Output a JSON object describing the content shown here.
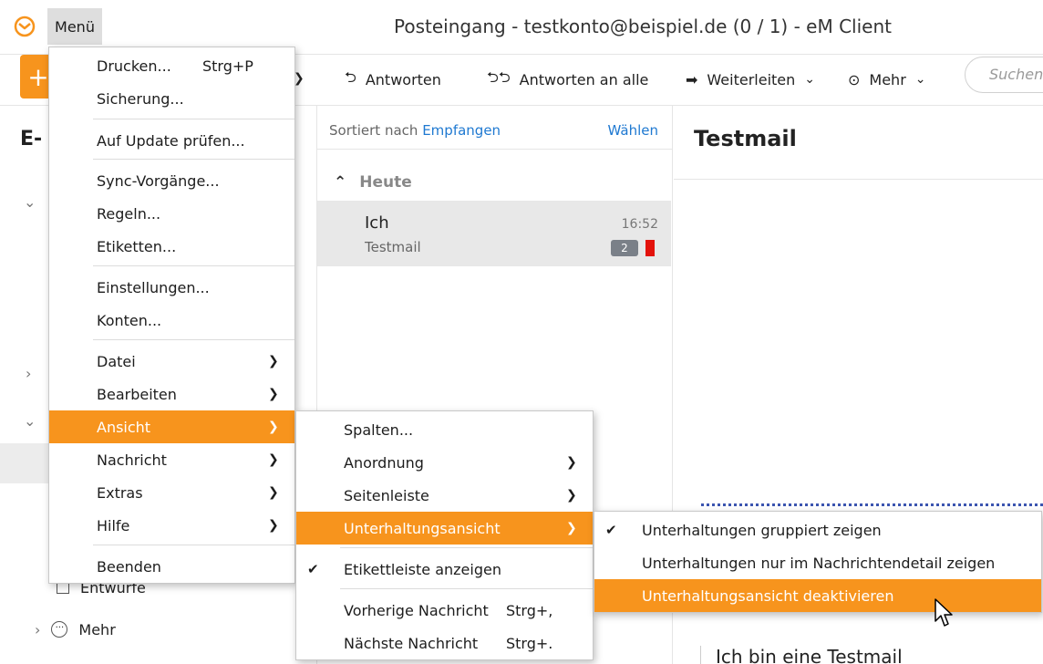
{
  "window": {
    "title": "Posteingang - testkonto@beispiel.de (0 / 1) - eM Client",
    "menu_button": "Menü"
  },
  "toolbar": {
    "new_icon": "plus-icon",
    "reply": "Antworten",
    "reply_all": "Antworten an alle",
    "forward": "Weiterleiten",
    "more": "Mehr",
    "search_placeholder": "Suchen"
  },
  "sidebar": {
    "title": "E-",
    "folders": [
      {
        "label": "Entwürfe",
        "icon": "draft-checkbox-icon"
      },
      {
        "label": "Mehr",
        "icon": "more-dots-icon"
      }
    ]
  },
  "message_list": {
    "sorted_by_prefix": "Sortiert nach",
    "sorted_by_field": "Empfangen",
    "choose": "Wählen",
    "group": "Heute",
    "messages": [
      {
        "sender": "Ich",
        "subject": "Testmail",
        "time": "16:52",
        "count": "2",
        "flag_color": "#e3120b"
      }
    ]
  },
  "reading_pane": {
    "subject": "Testmail",
    "body_text": "Ich bin eine Testmail"
  },
  "main_menu": {
    "items": [
      {
        "label": "Drucken...",
        "shortcut": "Strg+P"
      },
      {
        "label": "Sicherung..."
      },
      {
        "label": "Auf Update prüfen..."
      },
      {
        "label": "Sync-Vorgänge..."
      },
      {
        "label": "Regeln..."
      },
      {
        "label": "Etiketten..."
      },
      {
        "label": "Einstellungen..."
      },
      {
        "label": "Konten..."
      },
      {
        "label": "Datei"
      },
      {
        "label": "Bearbeiten"
      },
      {
        "label": "Ansicht"
      },
      {
        "label": "Nachricht"
      },
      {
        "label": "Extras"
      },
      {
        "label": "Hilfe"
      },
      {
        "label": "Beenden"
      }
    ]
  },
  "view_menu": {
    "items": [
      {
        "label": "Spalten..."
      },
      {
        "label": "Anordnung"
      },
      {
        "label": "Seitenleiste"
      },
      {
        "label": "Unterhaltungsansicht"
      },
      {
        "label": "Etikettleiste anzeigen",
        "checked": true
      },
      {
        "label": "Vorherige Nachricht",
        "shortcut": "Strg+,"
      },
      {
        "label": "Nächste Nachricht",
        "shortcut": "Strg+."
      }
    ]
  },
  "conversation_menu": {
    "items": [
      {
        "label": "Unterhaltungen gruppiert zeigen",
        "checked": true
      },
      {
        "label": "Unterhaltungen nur im Nachrichtendetail zeigen"
      },
      {
        "label": "Unterhaltungsansicht deaktivieren"
      }
    ]
  },
  "colors": {
    "accent": "#f7941d",
    "link": "#1f79d1"
  }
}
